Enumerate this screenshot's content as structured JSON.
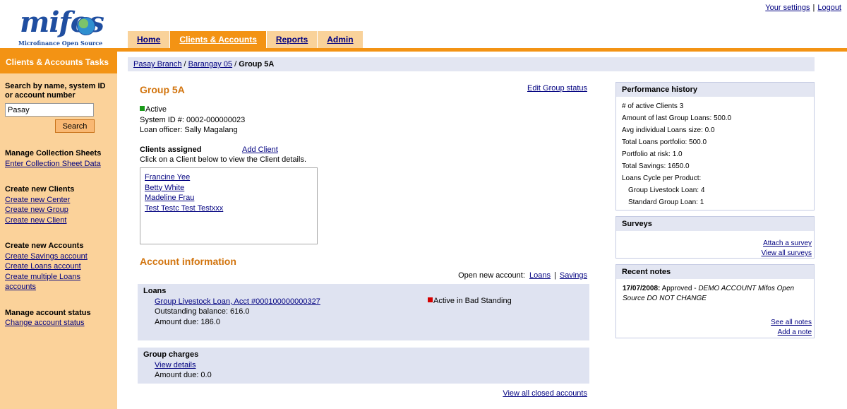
{
  "header": {
    "logo_word": "mifos",
    "logo_tagline": "Microfinance Open Source",
    "top_links": {
      "settings": "Your settings",
      "separator": "|",
      "logout": "Logout"
    },
    "tabs": [
      {
        "label": "Home",
        "active": false
      },
      {
        "label": "Clients & Accounts",
        "active": true
      },
      {
        "label": "Reports",
        "active": false
      },
      {
        "label": "Admin",
        "active": false
      }
    ]
  },
  "sidebar": {
    "title": "Clients & Accounts Tasks",
    "search_label": "Search by name, system ID or account number",
    "search_value": "Pasay",
    "search_button": "Search",
    "collection": {
      "heading": "Manage Collection Sheets",
      "links": [
        "Enter Collection Sheet Data"
      ]
    },
    "new_clients": {
      "heading": "Create new Clients",
      "links": [
        "Create new Center",
        "Create new Group",
        "Create new Client"
      ]
    },
    "new_accounts": {
      "heading": "Create new Accounts",
      "links": [
        "Create Savings account",
        "Create Loans account",
        "Create multiple Loans accounts"
      ]
    },
    "account_status": {
      "heading": "Manage account status",
      "links": [
        "Change account status"
      ]
    }
  },
  "breadcrumb": {
    "branch": "Pasay Branch",
    "sep": "/",
    "center": "Barangay 05",
    "current": "Group 5A"
  },
  "group": {
    "title": "Group 5A",
    "edit_status": "Edit Group status",
    "status": "Active",
    "system_id": "System ID #: 0002-000000023",
    "loan_officer": "Loan officer: Sally Magalang",
    "clients_heading": "Clients assigned",
    "add_client": "Add Client",
    "clients_hint": "Click on a Client below to view the Client details.",
    "clients": [
      "Francine Yee",
      "Betty White",
      "Madeline Frau",
      "Test Testc Test Testxxx"
    ]
  },
  "accounts": {
    "title": "Account information",
    "open_new_label": "Open new account:",
    "open_loans": "Loans",
    "sep": "|",
    "open_savings": "Savings",
    "loans": {
      "heading": "Loans",
      "loan_link": "Group Livestock Loan, Acct #000100000000327",
      "status": "Active in Bad Standing",
      "outstanding": "Outstanding balance: 616.0",
      "due": "Amount due: 186.0"
    },
    "charges": {
      "heading": "Group charges",
      "link": "View details",
      "due": "Amount due: 0.0"
    },
    "closed_link": "View all closed accounts"
  },
  "performance": {
    "title": "Performance history",
    "lines": [
      "# of active Clients 3",
      "Amount of last Group Loans: 500.0",
      "Avg individual Loans size: 0.0",
      "Total Loans portfolio: 500.0",
      "Portfolio at risk: 1.0",
      "Total Savings: 1650.0",
      "Loans Cycle per Product:"
    ],
    "cycles": [
      "Group Livestock Loan: 4",
      "Standard Group Loan: 1"
    ]
  },
  "surveys": {
    "title": "Surveys",
    "attach": "Attach a survey",
    "view_all": "View all surveys"
  },
  "notes": {
    "title": "Recent notes",
    "date": "17/07/2008:",
    "text_plain": " Approved - ",
    "text_italic": "DEMO ACCOUNT Mifos Open Source DO NOT CHANGE",
    "see_all": "See all notes",
    "add": "Add a note"
  },
  "colors": {
    "accent_orange": "#f39314",
    "sidebar_bg": "#fbd29a",
    "link": "#000080",
    "title_orange": "#d2750f",
    "panel_bg": "#e3e6f2"
  }
}
